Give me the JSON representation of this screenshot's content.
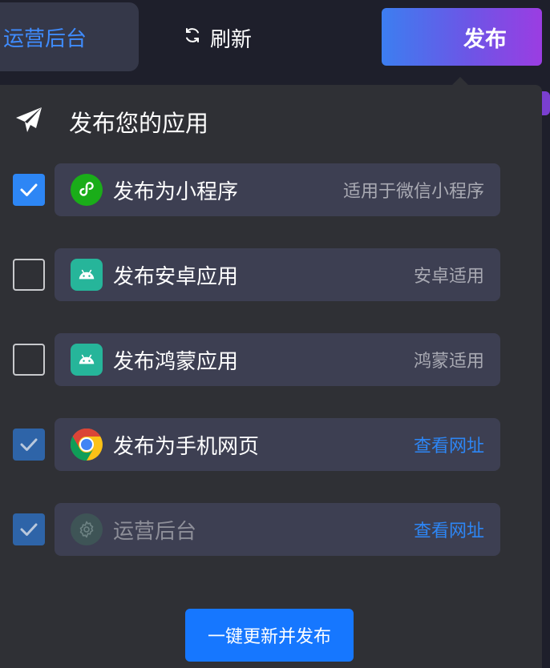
{
  "topbar": {
    "admin_tab": "运营后台",
    "refresh_label": "刷新",
    "publish_label": "发布"
  },
  "panel": {
    "title": "发布您的应用",
    "icon": "paper-plane-icon",
    "options": [
      {
        "label": "发布为小程序",
        "hint": "适用于微信小程序",
        "checked": true,
        "icon": "wechat-miniprogram-icon",
        "icon_color": "#1aad19"
      },
      {
        "label": "发布安卓应用",
        "hint": "安卓适用",
        "checked": false,
        "icon": "android-icon",
        "icon_color": "#26b59a"
      },
      {
        "label": "发布鸿蒙应用",
        "hint": "鸿蒙适用",
        "checked": false,
        "icon": "android-icon",
        "icon_color": "#26b59a"
      },
      {
        "label": "发布为手机网页",
        "hint": "查看网址",
        "checked": true,
        "icon": "chrome-icon"
      },
      {
        "label": "运营后台",
        "hint": "查看网址",
        "checked": true,
        "icon": "gear-icon",
        "disabled": true
      }
    ],
    "action_label": "一键更新并发布"
  },
  "colors": {
    "accent": "#1677ff",
    "publish_gradient": [
      "#3c7ef0",
      "#9b3de2"
    ],
    "panel_bg": "#2f3035",
    "card_bg": "#3d3f52"
  }
}
